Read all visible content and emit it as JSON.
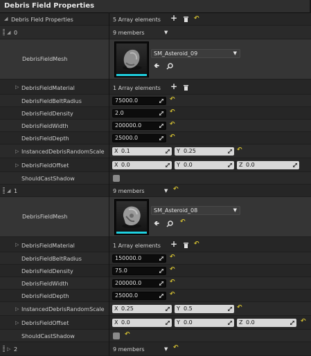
{
  "panel_title": "Debris Field Properties",
  "root": {
    "label": "Debris Field Properties",
    "count_text": "5 Array elements"
  },
  "labels": {
    "mesh": "DebrisFieldMesh",
    "material": "DebrisFieldMaterial",
    "belt_radius": "DebrisFieldBeltRadius",
    "density": "DebrisFieldDensity",
    "width": "DebrisFieldWidth",
    "depth": "DebrisFieldDepth",
    "scale": "InstancedDebrisRandomScale",
    "offset": "DebrisFieldOffset",
    "shadow": "ShouldCastShadow"
  },
  "axis": {
    "x": "X",
    "y": "Y",
    "z": "Z"
  },
  "elements": [
    {
      "index": "0",
      "members": "9 members",
      "mesh_name": "SM_Asteroid_09",
      "material_count": "1 Array elements",
      "belt_radius": "75000.0",
      "density": "2.0",
      "width": "200000.0",
      "depth": "25000.0",
      "scale_x": "0.1",
      "scale_y": "0.25",
      "offset_x": "0.0",
      "offset_y": "0.0",
      "offset_z": "0.0",
      "shadow": false
    },
    {
      "index": "1",
      "members": "9 members",
      "mesh_name": "SM_Asteroid_08",
      "material_count": "1 Array elements",
      "belt_radius": "150000.0",
      "density": "75.0",
      "width": "200000.0",
      "depth": "25000.0",
      "scale_x": "0.25",
      "scale_y": "0.5",
      "offset_x": "0.0",
      "offset_y": "0.0",
      "offset_z": "0.0",
      "shadow": false
    },
    {
      "index": "2",
      "members": "9 members"
    }
  ],
  "colors": {
    "reset_arrow": "#d6c232",
    "thumbnail_bar": "#1fd0e0"
  }
}
